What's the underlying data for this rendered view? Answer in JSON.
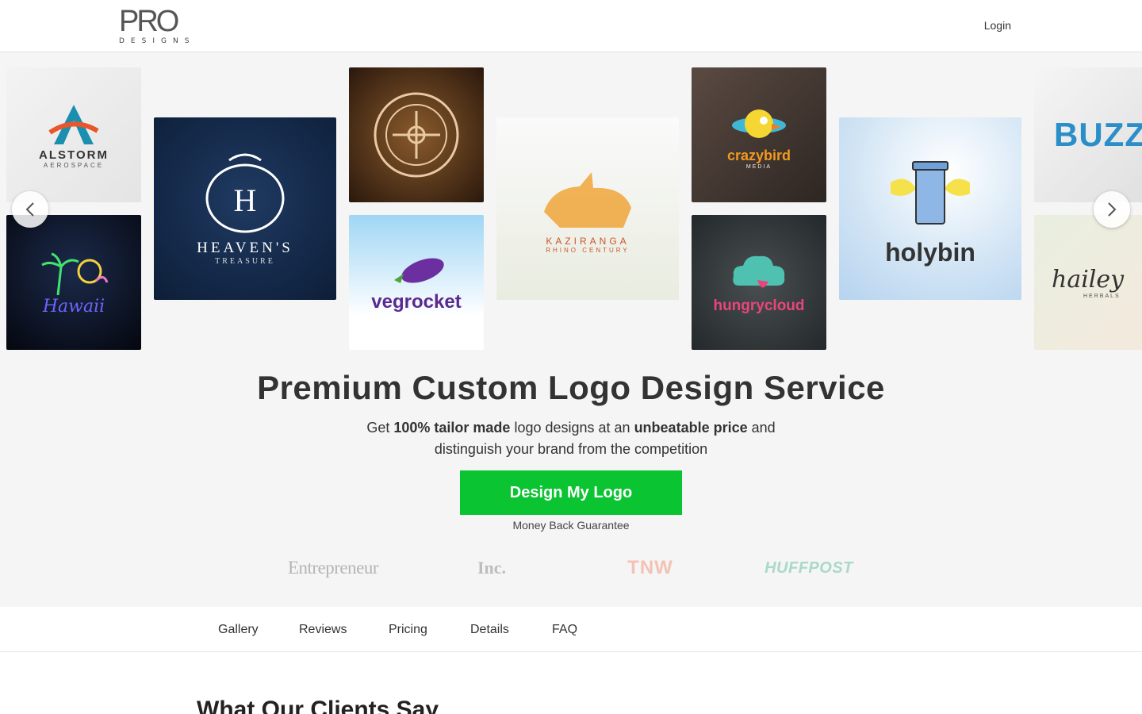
{
  "header": {
    "logo_mark": "PRO",
    "logo_sub": "DESIGNS",
    "login_label": "Login"
  },
  "carousel": {
    "prev_icon": "chevron-left-icon",
    "next_icon": "chevron-right-icon",
    "tiles": [
      {
        "label": "ALSTORM",
        "sub": "AEROSPACE"
      },
      {
        "label": "Hawaii",
        "sub": ""
      },
      {
        "label": "HEAVEN'S",
        "sub": "TREASURE"
      },
      {
        "label": "",
        "sub": ""
      },
      {
        "label": "vegrocket",
        "sub": ""
      },
      {
        "label": "KAZIRANGA",
        "sub": "RHINO CENTURY"
      },
      {
        "label": "crazybird",
        "sub": "MEDIA"
      },
      {
        "label": "hungrycloud",
        "sub": ""
      },
      {
        "label": "holybin",
        "sub": ""
      },
      {
        "label": "BUZZ",
        "sub": ""
      },
      {
        "label": "hailey",
        "sub": "HERBALS"
      }
    ]
  },
  "hero": {
    "title": "Premium Custom Logo Design Service",
    "sub_1": "Get ",
    "sub_bold_1": "100% tailor made",
    "sub_2": " logo designs at an ",
    "sub_bold_2": "unbeatable price",
    "sub_3": " and",
    "sub_line2": "distinguish your brand from the competition",
    "cta_label": "Design My Logo",
    "guarantee": "Money Back Guarantee"
  },
  "press": [
    "Entrepreneur",
    "Inc.",
    "TNW",
    "HUFFPOST"
  ],
  "subnav": [
    "Gallery",
    "Reviews",
    "Pricing",
    "Details",
    "FAQ"
  ],
  "section": {
    "title": "What Our Clients Say"
  },
  "colors": {
    "cta": "#0ac431",
    "background": "#f5f5f5"
  }
}
